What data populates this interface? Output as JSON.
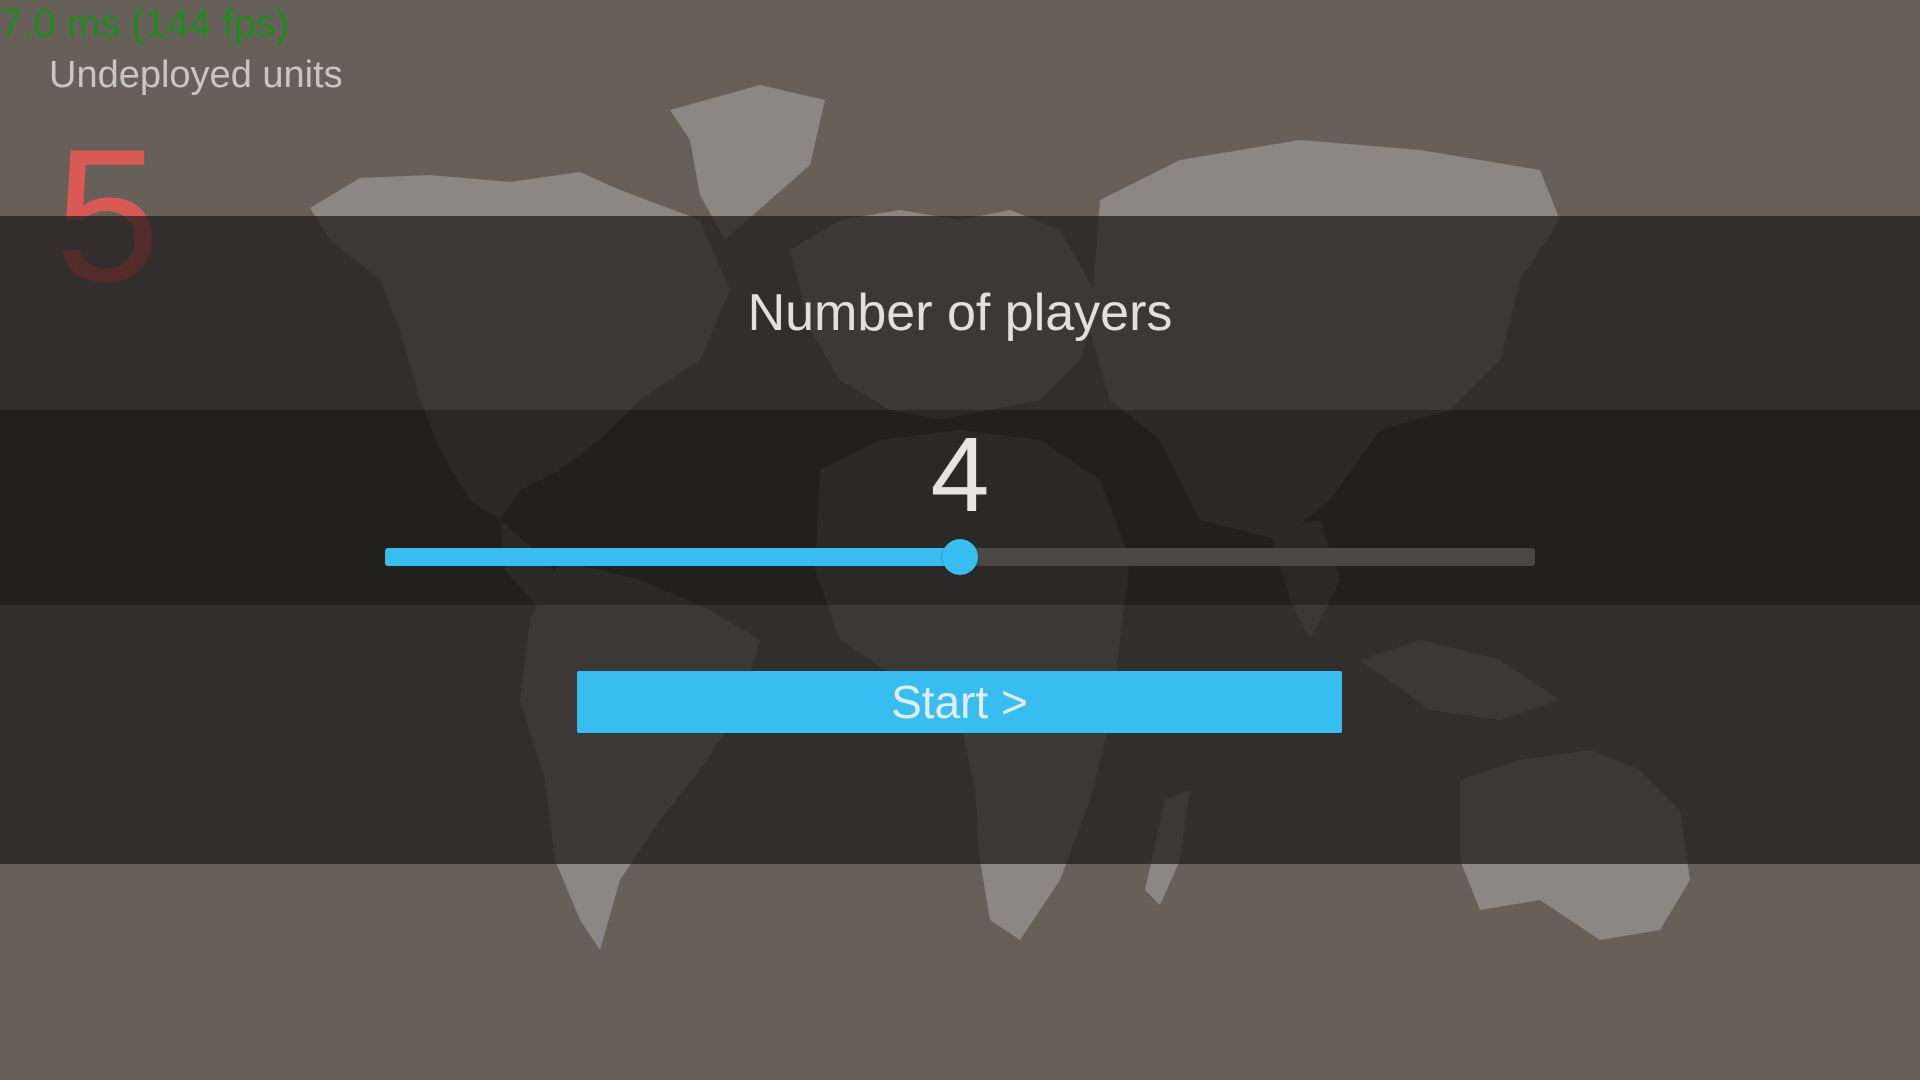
{
  "hud": {
    "fps_text": "7.0 ms (144 fps)",
    "units_label": "Undeployed units",
    "units_count": "5"
  },
  "setup_panel": {
    "title": "Number of players",
    "player_count": "4",
    "slider": {
      "value": 4,
      "fraction": 0.5
    },
    "start_label": "Start >"
  },
  "colors": {
    "background": "#676059",
    "accent": "#38bdf0",
    "units_count": "#e35a55",
    "fps_text": "#1f8a1f"
  }
}
